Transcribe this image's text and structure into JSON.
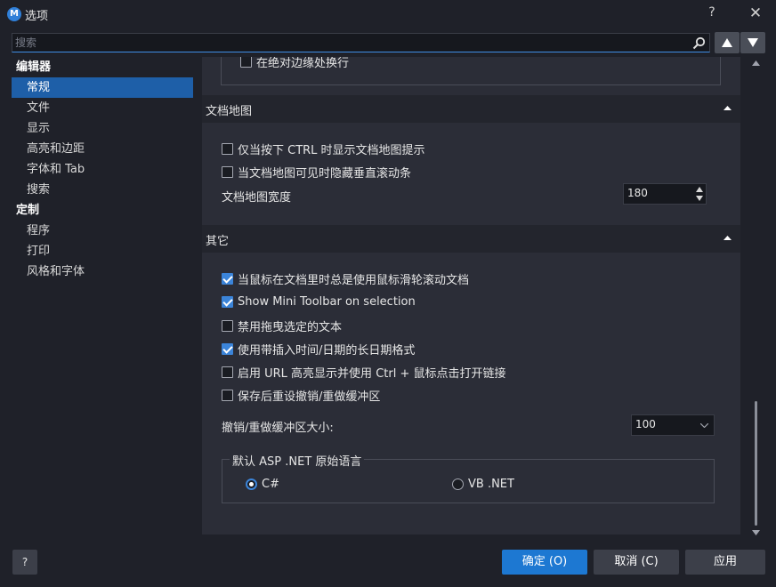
{
  "window": {
    "title": "选项",
    "icon_letter": "M",
    "help": "?",
    "close": "✕"
  },
  "search": {
    "placeholder": "搜索"
  },
  "sidebar": {
    "groups": [
      {
        "label": "编辑器",
        "items": [
          "常规",
          "文件",
          "显示",
          "高亮和边距",
          "字体和 Tab",
          "搜索"
        ]
      },
      {
        "label": "定制",
        "items": [
          "程序",
          "打印",
          "风格和字体"
        ]
      }
    ],
    "selected": "常规"
  },
  "top_option": {
    "label": "在绝对边缘处换行",
    "checked": false
  },
  "docmap": {
    "header": "文档地图",
    "options": [
      {
        "label": "仅当按下 CTRL 时显示文档地图提示",
        "checked": false
      },
      {
        "label": "当文档地图可见时隐藏垂直滚动条",
        "checked": false
      }
    ],
    "width_label": "文档地图宽度",
    "width_value": "180"
  },
  "other": {
    "header": "其它",
    "options": [
      {
        "label": "当鼠标在文档里时总是使用鼠标滑轮滚动文档",
        "checked": true
      },
      {
        "label": "Show Mini Toolbar on selection",
        "checked": true
      },
      {
        "label": "禁用拖曳选定的文本",
        "checked": false
      },
      {
        "label": "使用带插入时间/日期的长日期格式",
        "checked": true
      },
      {
        "label": "启用 URL 高亮显示并使用 Ctrl + 鼠标点击打开链接",
        "checked": false
      },
      {
        "label": "保存后重设撤销/重做缓冲区",
        "checked": false
      }
    ],
    "undo_label": "撤销/重做缓冲区大小:",
    "undo_value": "100",
    "asp_legend": "默认 ASP .NET 原始语言",
    "radio_csharp": "C#",
    "radio_vbnet": "VB .NET",
    "selected_language": "C#"
  },
  "buttons": {
    "help": "?",
    "ok": "确定 (O)",
    "cancel": "取消 (C)",
    "apply": "应用"
  },
  "colors": {
    "accent": "#1d78d2",
    "background": "#1f2129",
    "panel": "#2b2d37",
    "selected": "#1e5fa8"
  }
}
